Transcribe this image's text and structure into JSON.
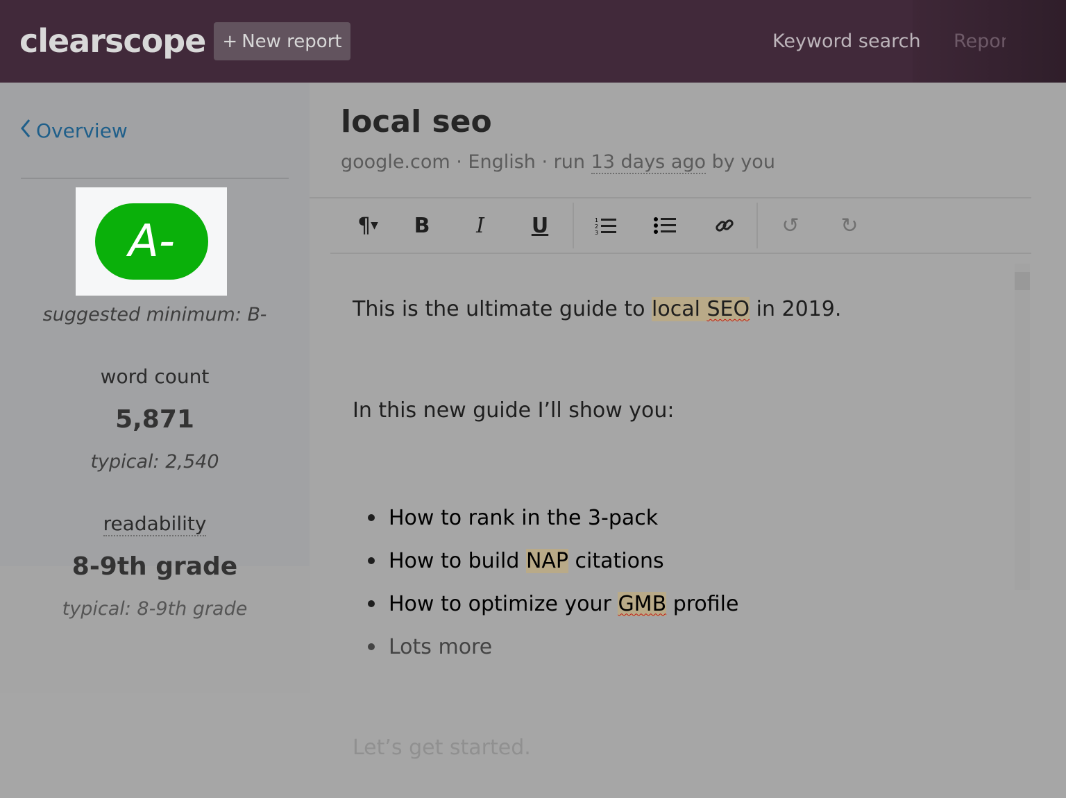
{
  "header": {
    "logo": "clearscope",
    "new_report": "New report",
    "new_report_icon": "plus-icon",
    "nav": [
      "Keyword search",
      "Repor"
    ]
  },
  "sidebar": {
    "back": "Overview",
    "grade": "A-",
    "grade_color": "#0ab00a",
    "suggested": "suggested minimum: B-",
    "word_count": {
      "label": "word count",
      "value": "5,871",
      "typical": "typical: 2,540"
    },
    "readability": {
      "label": "readability",
      "value": "8-9th grade",
      "typical": "typical: 8-9th grade"
    }
  },
  "report": {
    "title": "local seo",
    "meta_prefix": "google.com · English · run ",
    "meta_time": "13 days ago",
    "meta_suffix": " by you"
  },
  "toolbar": [
    "paragraph-icon",
    "bold-icon",
    "italic-icon",
    "underline-icon",
    "ordered-list-icon",
    "bullet-list-icon",
    "link-icon",
    "undo-icon",
    "redo-icon"
  ],
  "editor": {
    "p1": {
      "a": "This is the ultimate guide to ",
      "local": "local ",
      "seo": "SEO",
      "b": " in 2019."
    },
    "p2": "In this new guide I’ll show you:",
    "bullets": [
      {
        "a": "How to rank in the 3-pack"
      },
      {
        "a": "How to build ",
        "hl": "NAP",
        "b": " citations"
      },
      {
        "a": "How to optimize your ",
        "hl": "GMB",
        "b": " profile"
      },
      {
        "a": "Lots more"
      }
    ],
    "p3": "Let’s get started.",
    "highlight_color": "#b9aa88"
  }
}
